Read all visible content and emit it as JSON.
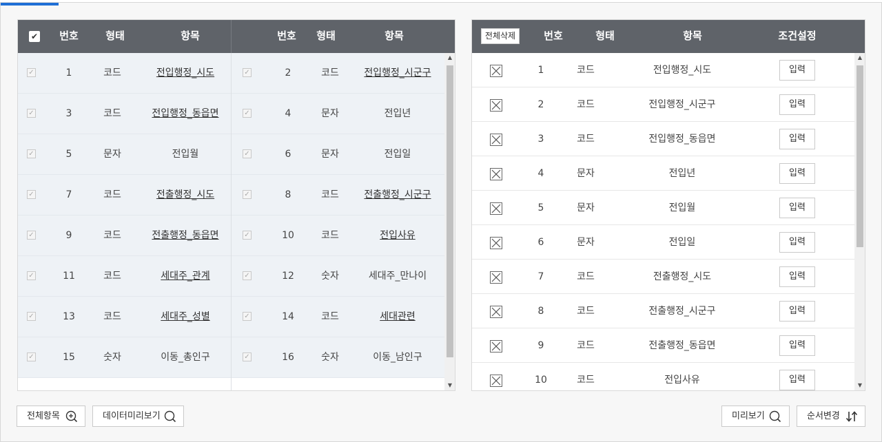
{
  "left_table": {
    "headers": {
      "number": "번호",
      "type": "형태",
      "item": "항목",
      "number2": "번호",
      "type2": "형태",
      "item2": "항목"
    },
    "rows": [
      {
        "a_no": "1",
        "a_type": "코드",
        "a_item": "전입행정_시도",
        "a_ul": true,
        "b_no": "2",
        "b_type": "코드",
        "b_item": "전입행정_시군구",
        "b_ul": true
      },
      {
        "a_no": "3",
        "a_type": "코드",
        "a_item": "전입행정_동읍면",
        "a_ul": true,
        "b_no": "4",
        "b_type": "문자",
        "b_item": "전입년",
        "b_ul": false
      },
      {
        "a_no": "5",
        "a_type": "문자",
        "a_item": "전입월",
        "a_ul": false,
        "b_no": "6",
        "b_type": "문자",
        "b_item": "전입일",
        "b_ul": false
      },
      {
        "a_no": "7",
        "a_type": "코드",
        "a_item": "전출행정_시도",
        "a_ul": true,
        "b_no": "8",
        "b_type": "코드",
        "b_item": "전출행정_시군구",
        "b_ul": true
      },
      {
        "a_no": "9",
        "a_type": "코드",
        "a_item": "전출행정_동읍면",
        "a_ul": true,
        "b_no": "10",
        "b_type": "코드",
        "b_item": "전입사유",
        "b_ul": true
      },
      {
        "a_no": "11",
        "a_type": "코드",
        "a_item": "세대주_관계",
        "a_ul": true,
        "b_no": "12",
        "b_type": "숫자",
        "b_item": "세대주_만나이",
        "b_ul": false
      },
      {
        "a_no": "13",
        "a_type": "코드",
        "a_item": "세대주_성별",
        "a_ul": true,
        "b_no": "14",
        "b_type": "코드",
        "b_item": "세대관련",
        "b_ul": true
      },
      {
        "a_no": "15",
        "a_type": "숫자",
        "a_item": "이동_총인구",
        "a_ul": false,
        "b_no": "16",
        "b_type": "숫자",
        "b_item": "이동_남인구",
        "b_ul": false
      }
    ]
  },
  "right_table": {
    "delete_all_label": "전체삭제",
    "headers": {
      "number": "번호",
      "type": "형태",
      "item": "항목",
      "condition": "조건설정"
    },
    "input_label": "입력",
    "rows": [
      {
        "no": "1",
        "type": "코드",
        "item": "전입행정_시도"
      },
      {
        "no": "2",
        "type": "코드",
        "item": "전입행정_시군구"
      },
      {
        "no": "3",
        "type": "코드",
        "item": "전입행정_동읍면"
      },
      {
        "no": "4",
        "type": "문자",
        "item": "전입년"
      },
      {
        "no": "5",
        "type": "문자",
        "item": "전입월"
      },
      {
        "no": "6",
        "type": "문자",
        "item": "전입일"
      },
      {
        "no": "7",
        "type": "코드",
        "item": "전출행정_시도"
      },
      {
        "no": "8",
        "type": "코드",
        "item": "전출행정_시군구"
      },
      {
        "no": "9",
        "type": "코드",
        "item": "전출행정_동읍면"
      },
      {
        "no": "10",
        "type": "코드",
        "item": "전입사유"
      }
    ]
  },
  "buttons": {
    "all_items": "전체항목",
    "data_preview": "데이터미리보기",
    "preview": "미리보기",
    "reorder": "순서변경"
  },
  "colors": {
    "header_bg": "#5f6369",
    "row_bg": "#eef2f6",
    "accent": "#1f6fd6"
  }
}
